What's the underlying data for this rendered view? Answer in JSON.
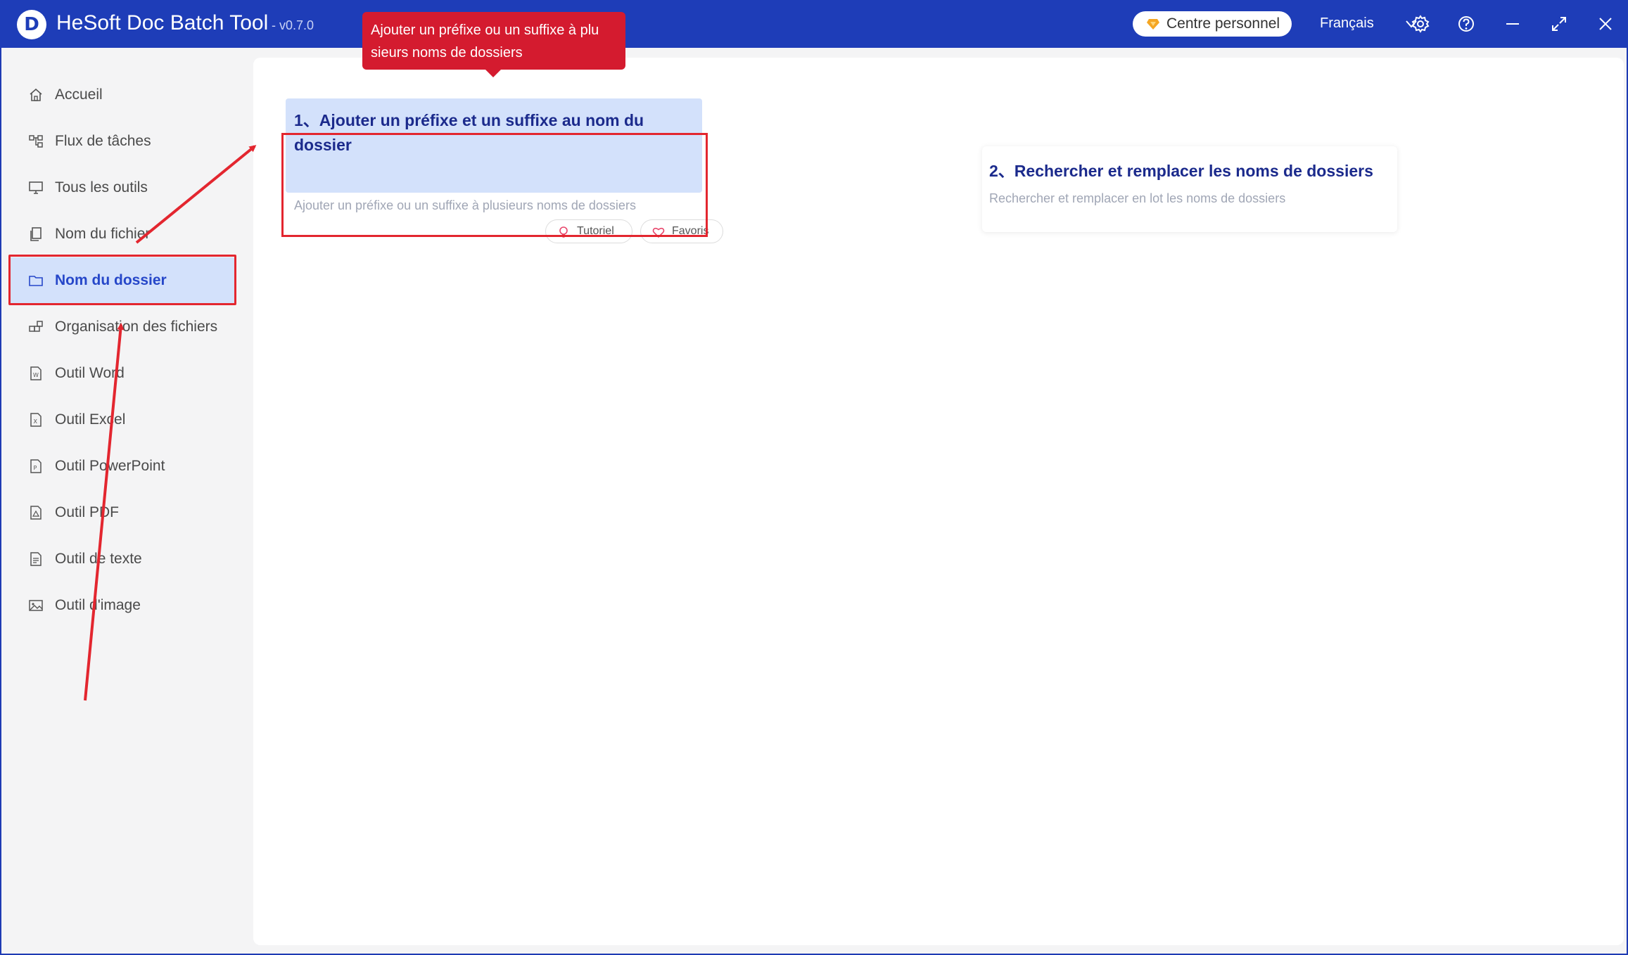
{
  "app": {
    "title": "HeSoft Doc Batch Tool",
    "version": "- v0.7.0",
    "logo_letter": "D",
    "personal_center": "Centre personnel",
    "language": "Français"
  },
  "sidebar": {
    "items": [
      {
        "label": "Accueil",
        "icon": "home-icon"
      },
      {
        "label": "Flux de tâches",
        "icon": "workflow-icon"
      },
      {
        "label": "Tous les outils",
        "icon": "monitor-icon"
      },
      {
        "label": "Nom du fichier",
        "icon": "file-copy-icon"
      },
      {
        "label": "Nom du dossier",
        "icon": "folder-icon",
        "active": true
      },
      {
        "label": "Organisation des fichiers",
        "icon": "organize-icon"
      },
      {
        "label": "Outil Word",
        "icon": "word-file-icon"
      },
      {
        "label": "Outil Excel",
        "icon": "excel-file-icon"
      },
      {
        "label": "Outil PowerPoint",
        "icon": "ppt-file-icon"
      },
      {
        "label": "Outil PDF",
        "icon": "pdf-file-icon"
      },
      {
        "label": "Outil de texte",
        "icon": "text-file-icon"
      },
      {
        "label": "Outil d'image",
        "icon": "image-icon"
      }
    ]
  },
  "tools": [
    {
      "title": "1、Ajouter un préfixe et un suffixe au nom du dossier",
      "description": "Ajouter un préfixe ou un suffixe à plusieurs noms de dossiers"
    },
    {
      "title": "2、Rechercher et remplacer les noms de dossiers",
      "description": "Rechercher et remplacer en lot les noms de dossiers"
    }
  ],
  "card_actions": {
    "tutorial": "Tutoriel",
    "favorite": "Favoris"
  },
  "tooltip": {
    "line1": "Ajouter un préfixe ou un suffixe à plu",
    "line2": "sieurs noms de dossiers"
  },
  "colors": {
    "titlebar": "#1e3db8",
    "accent": "#2647c9",
    "highlight": "#e3262f",
    "active_bg": "#d3e1fb",
    "tooltip_bg": "#d41b2f"
  }
}
